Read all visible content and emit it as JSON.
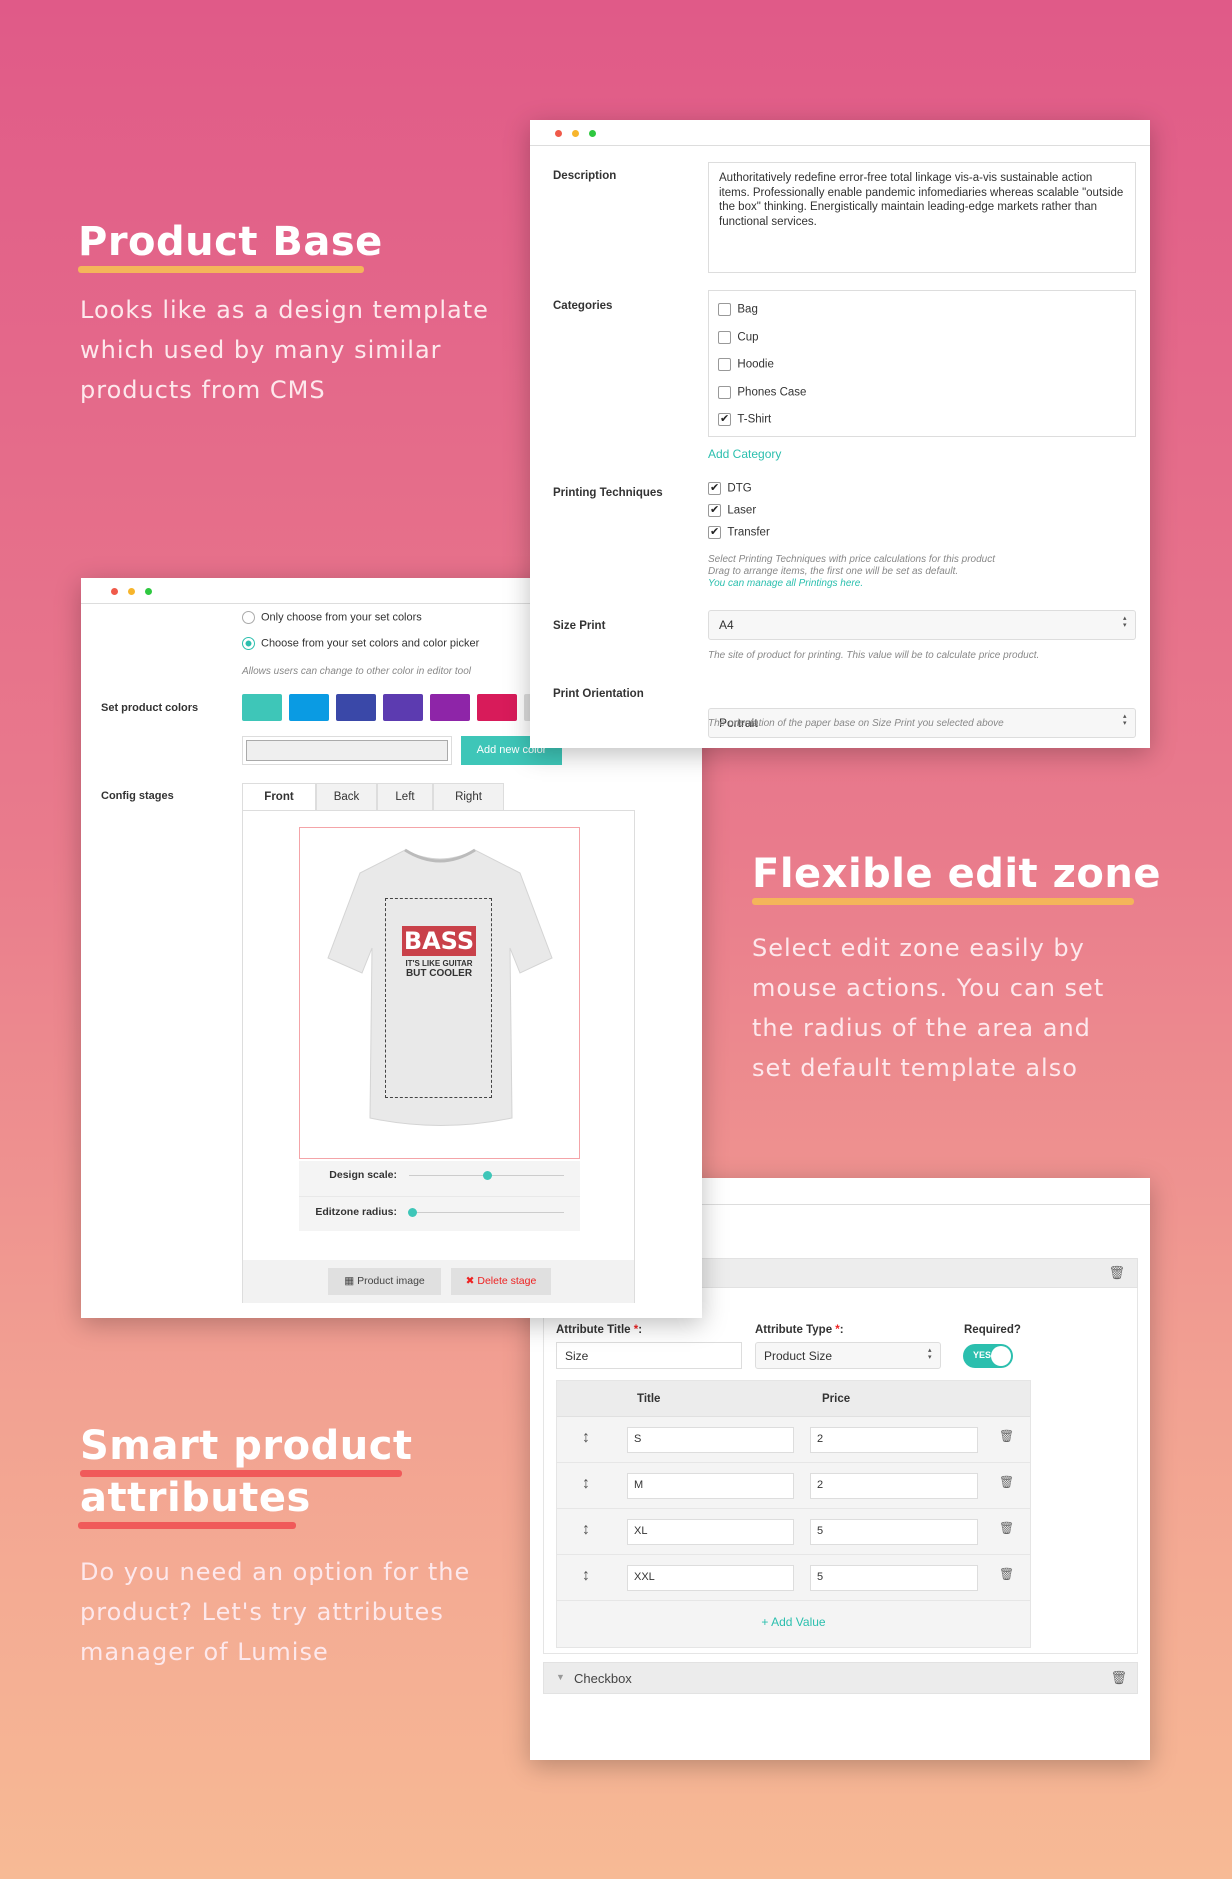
{
  "sections": [
    {
      "title": "Product Base",
      "text": [
        "Looks like as a design template",
        "which used by many similar",
        "products from CMS"
      ],
      "underline": "#f4b55a"
    },
    {
      "title": "Flexible edit zone",
      "text": [
        "Select edit zone easily by",
        "mouse actions. You can set",
        "the radius of the area and",
        "set default template also"
      ],
      "underline": "#f4b55a"
    },
    {
      "title": [
        "Smart product",
        "attributes"
      ],
      "text": [
        "Do you need an option for the",
        "product? Let's try attributes",
        "manager of Lumise"
      ],
      "underline": "#f05a5a"
    }
  ],
  "product_form": {
    "description_label": "Description",
    "description": "Authoritatively redefine error-free total linkage vis-a-vis sustainable action items. Professionally enable pandemic infomediaries whereas scalable \"outside the box\" thinking. Energistically maintain leading-edge markets rather than functional services.",
    "categories_label": "Categories",
    "categories": [
      {
        "label": "Bag",
        "checked": false
      },
      {
        "label": "Cup",
        "checked": false
      },
      {
        "label": "Hoodie",
        "checked": false
      },
      {
        "label": "Phones Case",
        "checked": false
      },
      {
        "label": "T-Shirt",
        "checked": true
      }
    ],
    "add_category": "Add Category",
    "printing_label": "Printing Techniques",
    "printings": [
      {
        "label": "DTG",
        "checked": true
      },
      {
        "label": "Laser",
        "checked": true
      },
      {
        "label": "Transfer",
        "checked": true
      }
    ],
    "printing_help1": "Select Printing Techniques with price calculations for this product",
    "printing_help2": "Drag to arrange items, the first one will be set as default.",
    "printing_link": "You can manage all Printings here.",
    "size_label": "Size Print",
    "size_value": "A4",
    "size_help": "The site of product for printing. This value will be to calculate price product.",
    "orient_label": "Print Orientation",
    "orient_value": "Portrait",
    "orient_help": "The orientation of the paper base on Size Print you selected above"
  },
  "stage_form": {
    "radio1": "Only choose from your set colors",
    "radio2": "Choose from your set colors and color picker",
    "radio_selected": 2,
    "radio_help": "Allows users can change to other color in editor tool",
    "colors_label": "Set product colors",
    "colors": [
      "#3ec6b8",
      "#0a9be3",
      "#3a48a8",
      "#5c3bb0",
      "#8e25a8",
      "#d81b5a",
      "#dddddd"
    ],
    "add_color": "Add new color",
    "stages_label": "Config stages",
    "tabs": [
      "Front",
      "Back",
      "Left",
      "Right"
    ],
    "active_tab": "Front",
    "design_text1": "BASS",
    "design_text2": "IT'S LIKE GUITAR",
    "design_text3": "BUT COOLER",
    "design_scale_label": "Design scale:",
    "design_scale": 0.5,
    "radius_label": "Editzone radius:",
    "radius": 0.02,
    "product_image": "Product image",
    "delete_stage": "Delete stage"
  },
  "attributes": {
    "title_label": "Attribute Title",
    "title_value": "Size",
    "type_label": "Attribute Type",
    "type_value": "Product Size",
    "required_label": "Required?",
    "required_toggle": "YES",
    "col_title": "Title",
    "col_price": "Price",
    "rows": [
      {
        "title": "S",
        "price": "2"
      },
      {
        "title": "M",
        "price": "2"
      },
      {
        "title": "XL",
        "price": "5"
      },
      {
        "title": "XXL",
        "price": "5"
      }
    ],
    "add_value": "Add Value",
    "next_attr": "Checkbox"
  },
  "accent": "#2bbfae"
}
